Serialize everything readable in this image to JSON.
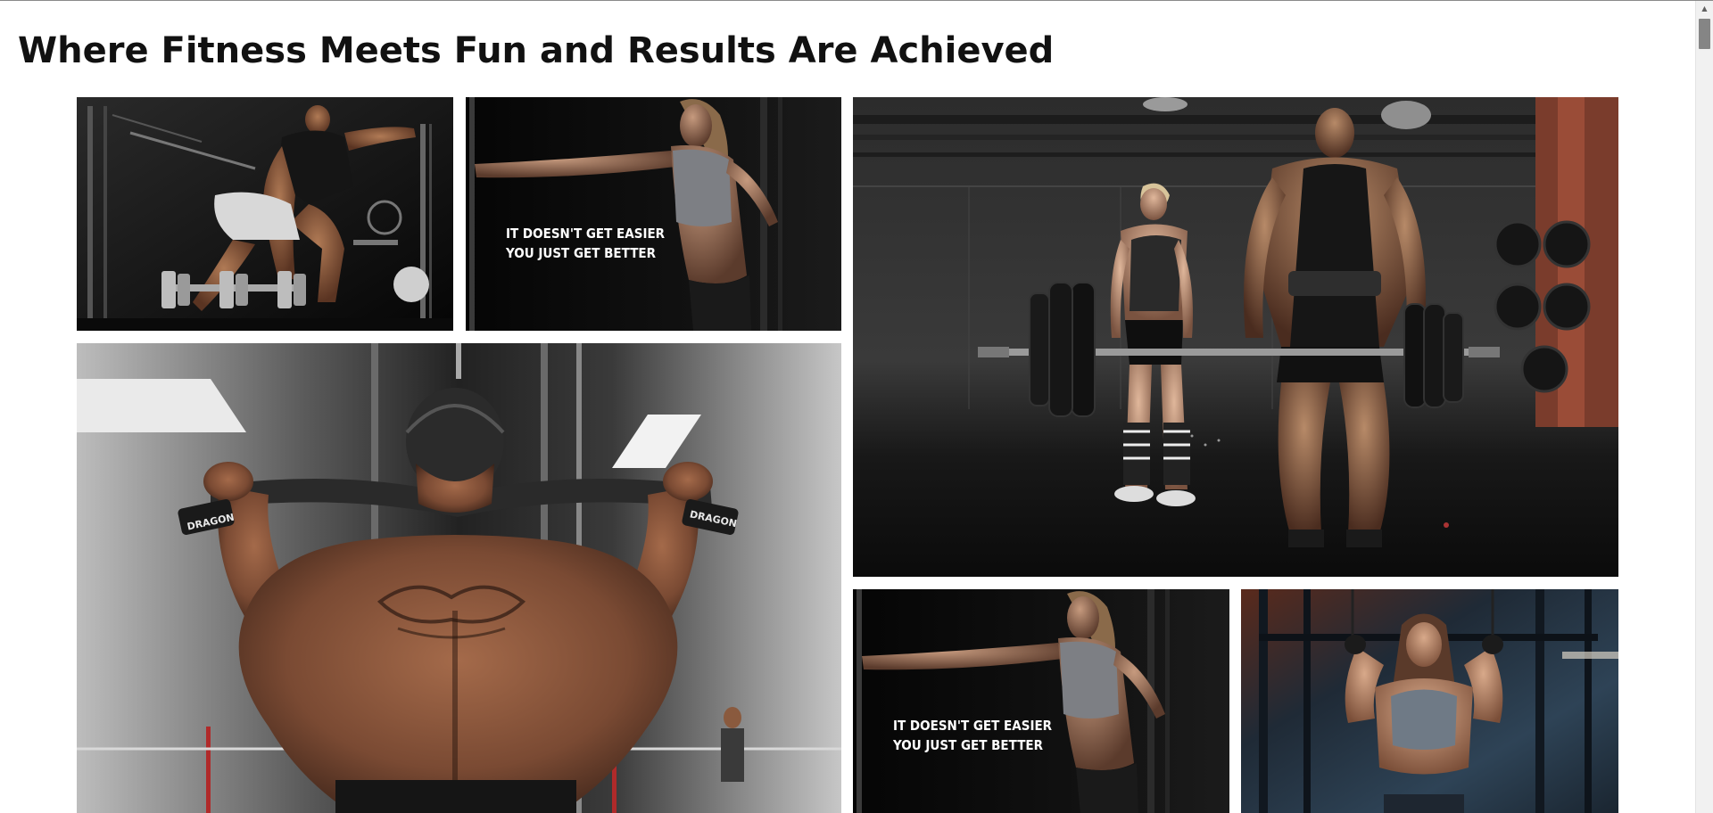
{
  "page": {
    "heading": "Where Fitness Meets Fun and Results Are Achieved"
  },
  "gallery": {
    "tiles": [
      {
        "subject": "man-deadlifting-dumbbells",
        "caption_line1": "",
        "caption_line2": ""
      },
      {
        "subject": "woman-stretching-motivation",
        "caption_line1": "IT DOESN'T GET EASIER",
        "caption_line2": "YOU JUST GET BETTER"
      },
      {
        "subject": "couple-barbell-deadlift",
        "caption_line1": "",
        "caption_line2": ""
      },
      {
        "subject": "tattooed-back-lat-pulldown",
        "caption_line1": "",
        "caption_line2": ""
      },
      {
        "subject": "woman-stretching-motivation",
        "caption_line1": "IT DOESN'T GET EASIER",
        "caption_line2": "YOU JUST GET BETTER"
      },
      {
        "subject": "woman-rig-pose",
        "caption_line1": "",
        "caption_line2": ""
      }
    ],
    "strap_label": "DRAGON"
  },
  "colors": {
    "tile_dark": "#0e0e10",
    "skin": "#8a5a3e",
    "accent_red": "#b5472f"
  }
}
